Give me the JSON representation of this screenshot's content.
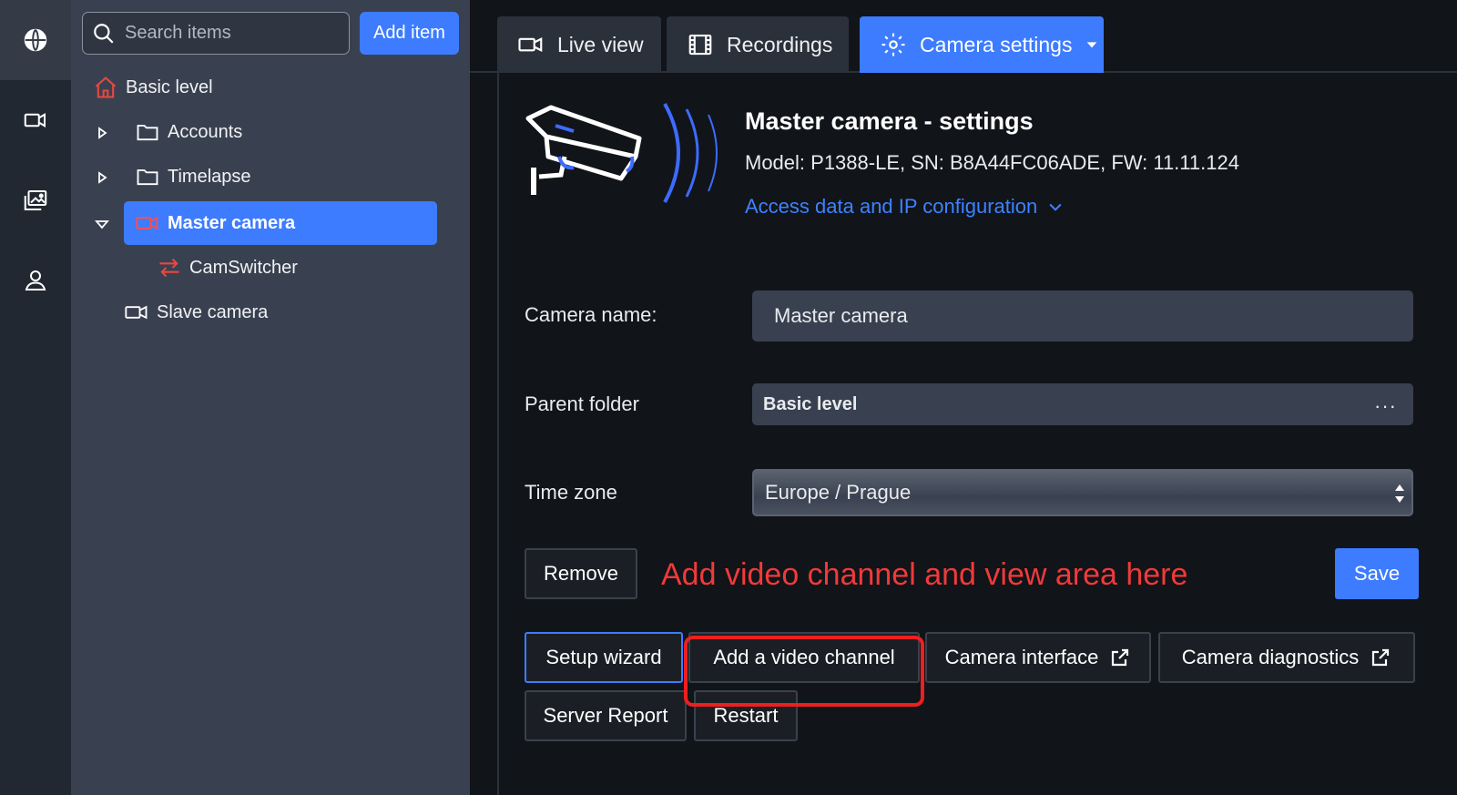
{
  "rail": {
    "items": [
      {
        "icon": "globe-icon",
        "active": true
      },
      {
        "icon": "camera-icon",
        "active": false
      },
      {
        "icon": "gallery-icon",
        "active": false
      },
      {
        "icon": "user-icon",
        "active": false
      }
    ]
  },
  "tree": {
    "search_placeholder": "Search items",
    "add_item_label": "Add item",
    "nodes": {
      "basic_level": "Basic level",
      "accounts": "Accounts",
      "timelapse": "Timelapse",
      "master_camera": "Master camera",
      "camswitcher": "CamSwitcher",
      "slave_camera": "Slave camera"
    }
  },
  "tabs": {
    "live_view": "Live view",
    "recordings": "Recordings",
    "camera_settings": "Camera settings"
  },
  "settings": {
    "title": "Master camera - settings",
    "model_line": "Model: P1388-LE, SN: B8A44FC06ADE, FW: 11.11.124",
    "access_link": "Access data and IP configuration",
    "camera_name_label": "Camera name:",
    "camera_name_value": "Master camera",
    "parent_folder_label": "Parent folder",
    "parent_folder_value": "Basic level",
    "parent_folder_more": "···",
    "time_zone_label": "Time zone",
    "time_zone_value": "Europe / Prague"
  },
  "actions": {
    "remove": "Remove",
    "save": "Save",
    "hint": "Add video channel and view area here",
    "setup_wizard": "Setup wizard",
    "add_video_channel": "Add a video channel",
    "camera_interface": "Camera interface",
    "camera_diagnostics": "Camera diagnostics",
    "server_report": "Server Report",
    "restart": "Restart"
  },
  "colors": {
    "accent": "#3d7cff",
    "annotation_red": "#ee1f1f",
    "home_icon": "#e8473f"
  }
}
